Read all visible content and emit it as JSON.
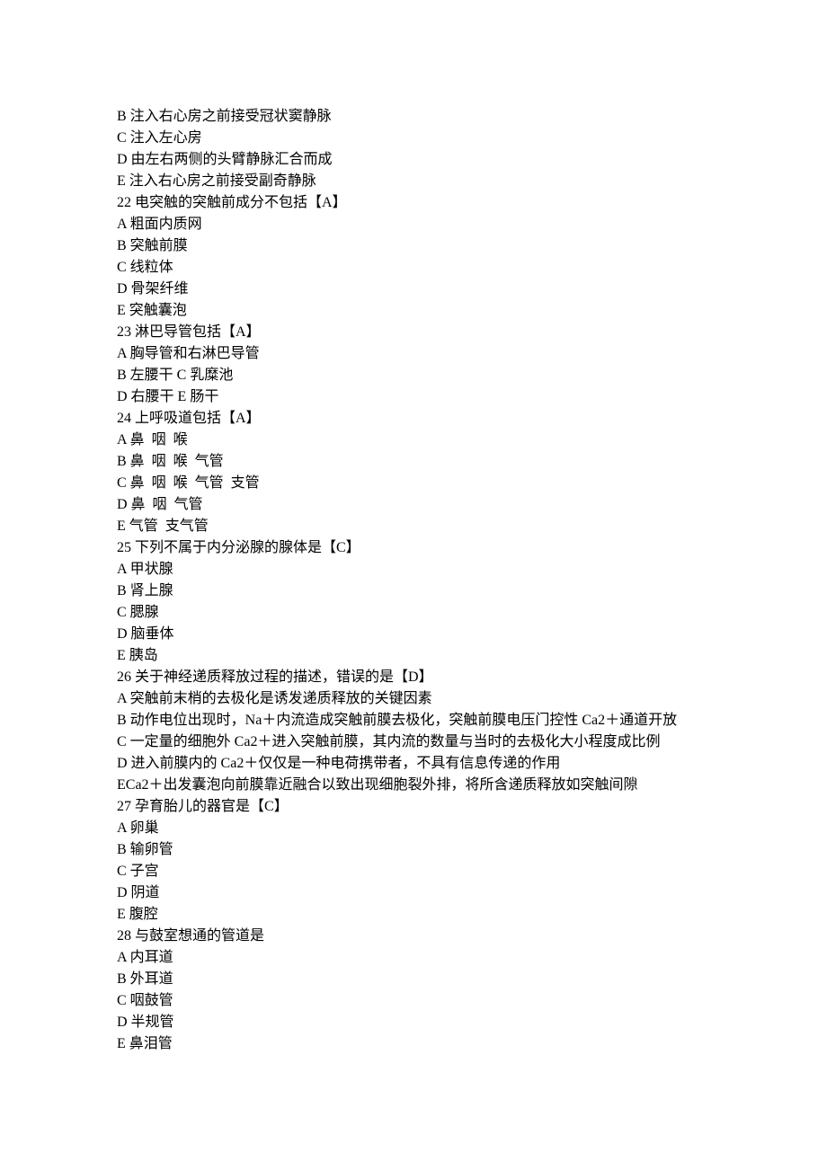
{
  "lines": [
    "B 注入右心房之前接受冠状窦静脉",
    "C 注入左心房",
    "D 由左右两侧的头臂静脉汇合而成",
    "E 注入右心房之前接受副奇静脉",
    "22 电突触的突触前成分不包括【A】",
    "A 粗面内质网",
    "B 突触前膜",
    "C 线粒体",
    "D 骨架纤维",
    "E 突触囊泡",
    "23 淋巴导管包括【A】",
    "A 胸导管和右淋巴导管",
    "B 左腰干 C 乳糜池",
    "D 右腰干 E 肠干",
    "24 上呼吸道包括【A】",
    "A 鼻  咽  喉",
    "B 鼻  咽  喉  气管",
    "C 鼻  咽  喉  气管  支管",
    "D 鼻  咽  气管",
    "E 气管  支气管",
    "25 下列不属于内分泌腺的腺体是【C】",
    "A 甲状腺",
    "B 肾上腺",
    "C 腮腺",
    "D 脑垂体",
    "E 胰岛",
    "26 关于神经递质释放过程的描述，错误的是【D】",
    "A 突触前末梢的去极化是诱发递质释放的关键因素",
    "B 动作电位出现时，Na＋内流造成突触前膜去极化，突触前膜电压门控性 Ca2＋通道开放",
    "C 一定量的细胞外 Ca2＋进入突触前膜，其内流的数量与当时的去极化大小程度成比例",
    "D 进入前膜内的 Ca2＋仅仅是一种电荷携带者，不具有信息传递的作用",
    "ECa2＋出发囊泡向前膜靠近融合以致出现细胞裂外排，将所含递质释放如突触间隙",
    "27 孕育胎儿的器官是【C】",
    "A 卵巢",
    "B 输卵管",
    "C 子宫",
    "D 阴道",
    "E 腹腔",
    "28 与鼓室想通的管道是",
    "A 内耳道",
    "B 外耳道",
    "C 咽鼓管",
    "D 半规管",
    "E 鼻泪管"
  ]
}
